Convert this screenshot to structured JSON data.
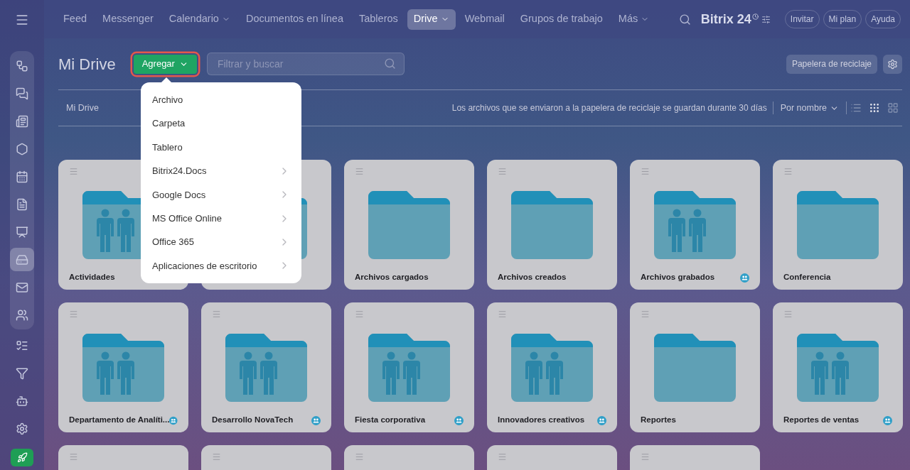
{
  "nav": [
    {
      "label": "Feed",
      "selected": false,
      "dropdown": false
    },
    {
      "label": "Messenger",
      "selected": false,
      "dropdown": false
    },
    {
      "label": "Calendario",
      "selected": false,
      "dropdown": true
    },
    {
      "label": "Documentos en línea",
      "selected": false,
      "dropdown": false
    },
    {
      "label": "Tableros",
      "selected": false,
      "dropdown": false
    },
    {
      "label": "Drive",
      "selected": true,
      "dropdown": true
    },
    {
      "label": "Webmail",
      "selected": false,
      "dropdown": false
    },
    {
      "label": "Grupos de trabajo",
      "selected": false,
      "dropdown": false
    },
    {
      "label": "Más",
      "selected": false,
      "dropdown": true
    }
  ],
  "logo": {
    "name": "Bitrix",
    "number": "24"
  },
  "header_buttons": [
    "Invitar",
    "Mi plan",
    "Ayuda"
  ],
  "sidebar": [
    {
      "kind": "flow",
      "selected": false
    },
    {
      "kind": "chat",
      "selected": false
    },
    {
      "kind": "news",
      "selected": false
    },
    {
      "kind": "hexagon",
      "selected": false
    },
    {
      "kind": "calendar",
      "selected": false
    },
    {
      "kind": "document",
      "selected": false
    },
    {
      "kind": "presentation",
      "selected": false
    },
    {
      "kind": "drive",
      "selected": true
    },
    {
      "kind": "mail",
      "selected": false
    },
    {
      "kind": "people",
      "selected": false
    },
    {
      "kind": "task",
      "selected": false
    },
    {
      "kind": "funnel",
      "selected": false
    },
    {
      "kind": "robot",
      "selected": false
    },
    {
      "kind": "settings",
      "selected": false
    },
    {
      "kind": "rocket",
      "selected": false
    }
  ],
  "page": {
    "title": "Mi Drive",
    "add_button": "Agregar",
    "search": {
      "placeholder": "Filtrar y buscar"
    },
    "trash_button": "Papelera de reciclaje"
  },
  "toolbar": {
    "breadcrumb": "Mi Drive",
    "notice": "Los archivos que se enviaron a la papelera de reciclaje se guardan durante 30 días",
    "sort": "Por nombre",
    "views": [
      {
        "kind": "list",
        "selected": false
      },
      {
        "kind": "grid",
        "selected": true
      },
      {
        "kind": "tiles",
        "selected": false
      }
    ]
  },
  "menu": [
    {
      "label": "Archivo",
      "submenu": false
    },
    {
      "label": "Carpeta",
      "submenu": false
    },
    {
      "label": "Tablero",
      "submenu": false
    },
    {
      "label": "Bitrix24.Docs",
      "submenu": true
    },
    {
      "label": "Google Docs",
      "submenu": true
    },
    {
      "label": "MS Office Online",
      "submenu": true
    },
    {
      "label": "Office 365",
      "submenu": true
    },
    {
      "label": "Aplicaciones de escritorio",
      "submenu": true
    }
  ],
  "folders": [
    {
      "kind": "folder",
      "name": "Actividades",
      "people": true,
      "shared": false
    },
    {
      "kind": "covered"
    },
    {
      "kind": "folder",
      "name": "Archivos cargados",
      "people": false,
      "shared": false
    },
    {
      "kind": "folder",
      "name": "Archivos creados",
      "people": false,
      "shared": false
    },
    {
      "kind": "folder",
      "name": "Archivos grabados",
      "people": true,
      "shared": true
    },
    {
      "kind": "folder",
      "name": "Conferencia",
      "people": false,
      "shared": false
    },
    {
      "kind": "folder",
      "name": "Departamento de Analíti...",
      "people": true,
      "shared": true
    },
    {
      "kind": "folder",
      "name": "Desarrollo NovaTech",
      "people": true,
      "shared": true
    },
    {
      "kind": "folder",
      "name": "Fiesta corporativa",
      "people": true,
      "shared": true
    },
    {
      "kind": "folder",
      "name": "Innovadores creativos",
      "people": true,
      "shared": true
    },
    {
      "kind": "folder",
      "name": "Reportes",
      "people": false,
      "shared": false
    },
    {
      "kind": "folder",
      "name": "Reportes de ventas",
      "people": true,
      "shared": true
    },
    {
      "kind": "stub"
    },
    {
      "kind": "stub"
    },
    {
      "kind": "stub"
    },
    {
      "kind": "stub"
    },
    {
      "kind": "stub"
    }
  ]
}
